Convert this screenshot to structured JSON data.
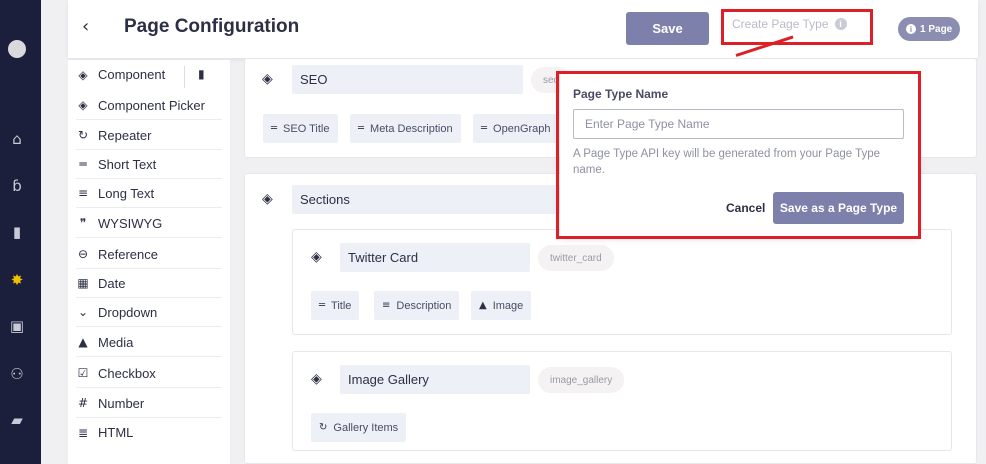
{
  "header": {
    "title": "Page Configuration",
    "save_label": "Save",
    "create_page_type_label": "Create Page Type",
    "page_count_label": "1 Page"
  },
  "components": [
    {
      "label": "Component",
      "icon": "layers-icon"
    },
    {
      "label": "Component Picker",
      "icon": "layers-plus-icon"
    },
    {
      "label": "Repeater",
      "icon": "repeat-icon"
    },
    {
      "label": "Short Text",
      "icon": "short-text-icon"
    },
    {
      "label": "Long Text",
      "icon": "long-text-icon"
    },
    {
      "label": "WYSIWYG",
      "icon": "quote-icon"
    },
    {
      "label": "Reference",
      "icon": "link-icon"
    },
    {
      "label": "Date",
      "icon": "calendar-icon"
    },
    {
      "label": "Dropdown",
      "icon": "chevron-down-icon"
    },
    {
      "label": "Media",
      "icon": "image-icon"
    },
    {
      "label": "Checkbox",
      "icon": "checkbox-icon"
    },
    {
      "label": "Number",
      "icon": "hash-icon"
    },
    {
      "label": "HTML",
      "icon": "html-icon"
    }
  ],
  "seo": {
    "title": "SEO",
    "slug": "seo",
    "chips": [
      "SEO Title",
      "Meta Description",
      "OpenGraph"
    ]
  },
  "sections": {
    "title": "Sections",
    "twitter_card": {
      "title": "Twitter Card",
      "slug": "twitter_card",
      "chips": [
        "Title",
        "Description",
        "Image"
      ]
    },
    "image_gallery": {
      "title": "Image Gallery",
      "slug": "image_gallery",
      "chips": [
        "Gallery Items"
      ]
    }
  },
  "popover": {
    "label": "Page Type Name",
    "placeholder": "Enter Page Type Name",
    "help": "A Page Type API key will be generated from your Page Type name.",
    "cancel_label": "Cancel",
    "save_label": "Save as a Page Type"
  },
  "colors": {
    "nav_bg": "#1c1f3b",
    "accent": "#7d80ab",
    "highlight": "#dd1f27",
    "active_nav": "#f2c200"
  }
}
